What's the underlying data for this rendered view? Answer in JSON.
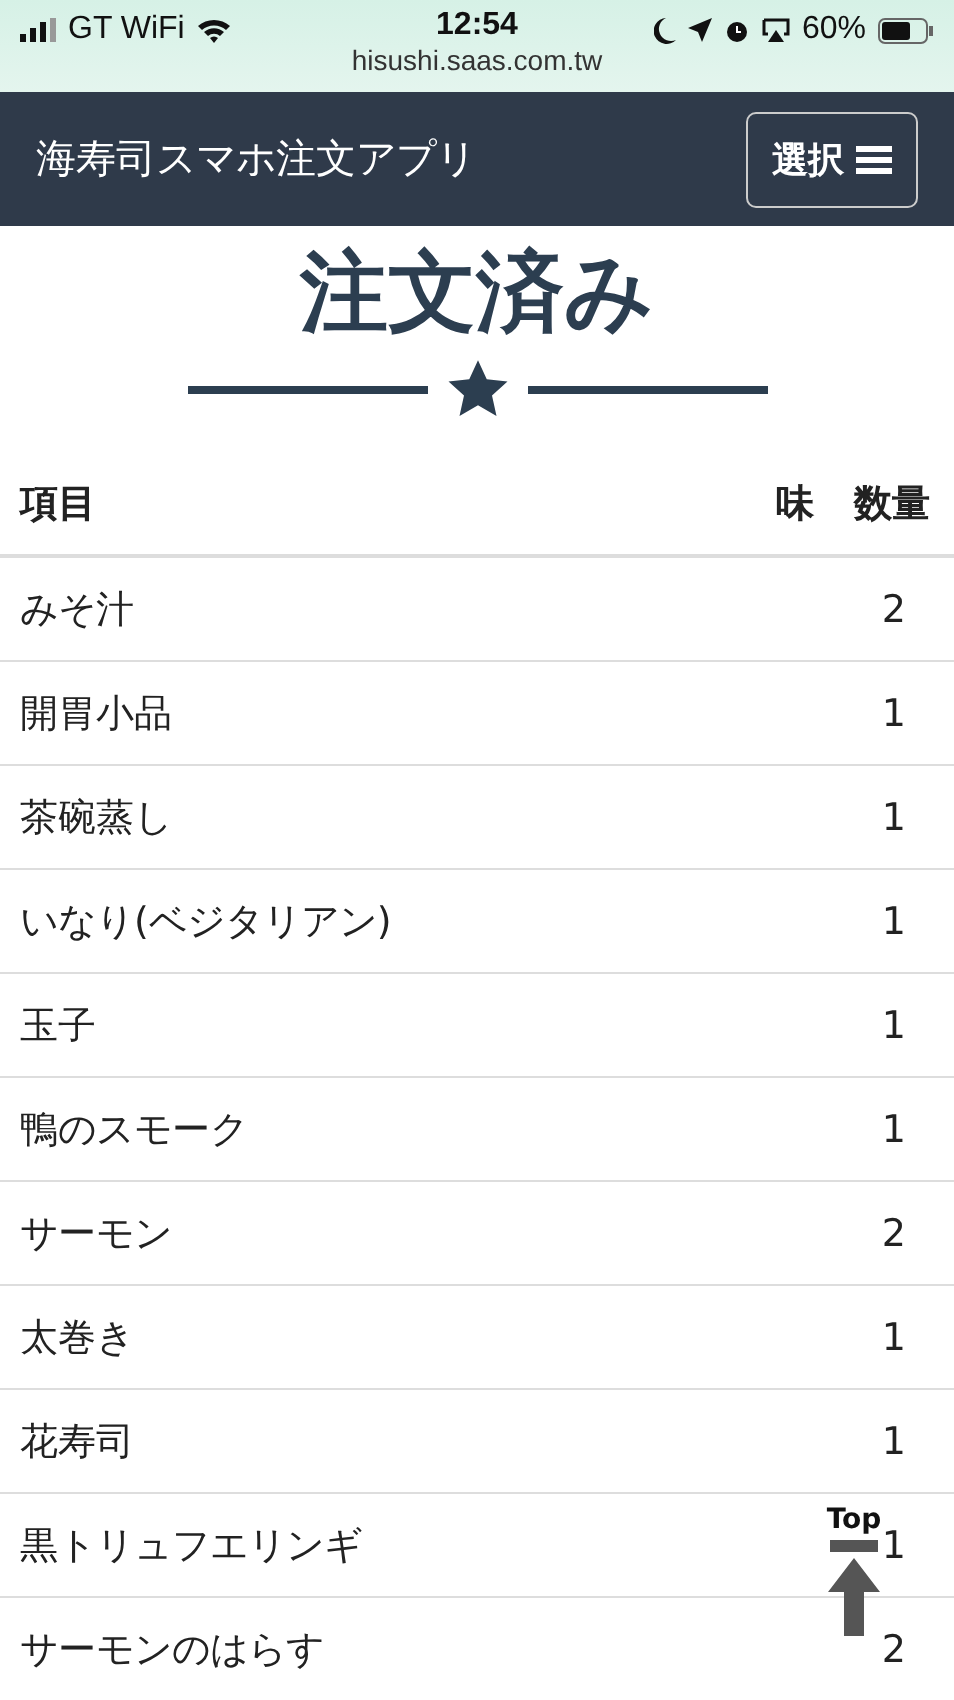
{
  "status_bar": {
    "carrier": "GT WiFi",
    "time": "12:54",
    "url": "hisushi.saas.com.tw",
    "battery_text": "60%"
  },
  "navbar": {
    "title": "海寿司スマホ注文アプリ",
    "menu_button": "選択"
  },
  "heading": "注文済み",
  "table": {
    "columns": [
      "項目",
      "味",
      "数量"
    ],
    "rows": [
      {
        "item": "みそ汁",
        "quantity": "2"
      },
      {
        "item": "開胃小品",
        "quantity": "1"
      },
      {
        "item": "茶碗蒸し",
        "quantity": "1"
      },
      {
        "item": "いなり(ベジタリアン)",
        "quantity": "1"
      },
      {
        "item": "玉子",
        "quantity": "1"
      },
      {
        "item": "鴨のスモーク",
        "quantity": "1"
      },
      {
        "item": "サーモン",
        "quantity": "2"
      },
      {
        "item": "太巻き",
        "quantity": "1"
      },
      {
        "item": "花寿司",
        "quantity": "1"
      },
      {
        "item": "黒トリュフエリンギ",
        "quantity": "1"
      },
      {
        "item": "サーモンのはらす",
        "quantity": "2"
      }
    ]
  },
  "top_button": "Top"
}
